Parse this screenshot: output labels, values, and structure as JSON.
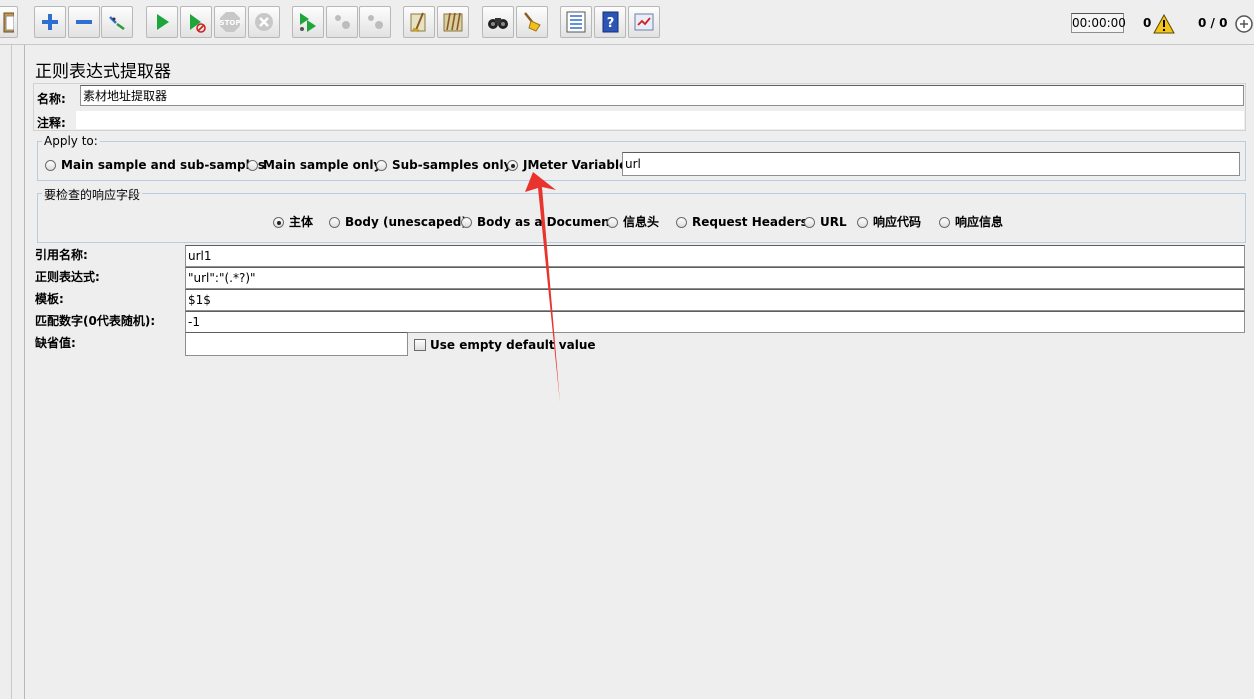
{
  "toolbar": {
    "buttons": [
      {
        "name": "clipboard-icon"
      },
      {
        "name": "add-icon"
      },
      {
        "name": "remove-icon"
      },
      {
        "name": "toggle-icon"
      },
      {
        "name": "start-icon"
      },
      {
        "name": "start-no-pauses-icon"
      },
      {
        "name": "stop-icon"
      },
      {
        "name": "shutdown-icon"
      },
      {
        "name": "remote-start-icon"
      },
      {
        "name": "remote-stop-icon"
      },
      {
        "name": "remote-shutdown-icon"
      },
      {
        "name": "clear-icon"
      },
      {
        "name": "clear-all-icon"
      },
      {
        "name": "search-icon"
      },
      {
        "name": "reset-search-icon"
      },
      {
        "name": "function-helper-icon"
      },
      {
        "name": "help-icon"
      },
      {
        "name": "log-viewer-icon"
      }
    ],
    "timer": "00:00:00",
    "warning_count": "0",
    "thread_count": "0 / 0"
  },
  "panel": {
    "title": "正则表达式提取器",
    "name_label": "名称:",
    "name_value": "素材地址提取器",
    "comment_label": "注释:",
    "comment_value": ""
  },
  "apply_to": {
    "legend": "Apply to:",
    "options": [
      {
        "label": "Main sample and sub-samples",
        "selected": false
      },
      {
        "label": "Main sample only",
        "selected": false
      },
      {
        "label": "Sub-samples only",
        "selected": false
      },
      {
        "label": "JMeter Variable",
        "selected": true
      }
    ],
    "variable_value": "url"
  },
  "field_to_check": {
    "legend": "要检查的响应字段",
    "options": [
      {
        "label": "主体",
        "selected": true
      },
      {
        "label": "Body (unescaped)",
        "selected": false
      },
      {
        "label": "Body as a Document",
        "selected": false
      },
      {
        "label": "信息头",
        "selected": false
      },
      {
        "label": "Request Headers",
        "selected": false
      },
      {
        "label": "URL",
        "selected": false
      },
      {
        "label": "响应代码",
        "selected": false
      },
      {
        "label": "响应信息",
        "selected": false
      }
    ]
  },
  "fields": {
    "ref_name_label": "引用名称:",
    "ref_name_value": "url1",
    "regex_label": "正则表达式:",
    "regex_value": "\"url\":\"(.*?)\"",
    "template_label": "模板:",
    "template_value": "$1$",
    "match_no_label": "匹配数字(0代表随机):",
    "match_no_value": "-1",
    "default_label": "缺省值:",
    "default_value": "",
    "empty_default_label": "Use empty default value",
    "empty_default_checked": false
  },
  "colors": {
    "annotation_arrow": "#e8342c",
    "panel_bg": "#eeeeee",
    "fieldset_border": "#b9cde0"
  }
}
